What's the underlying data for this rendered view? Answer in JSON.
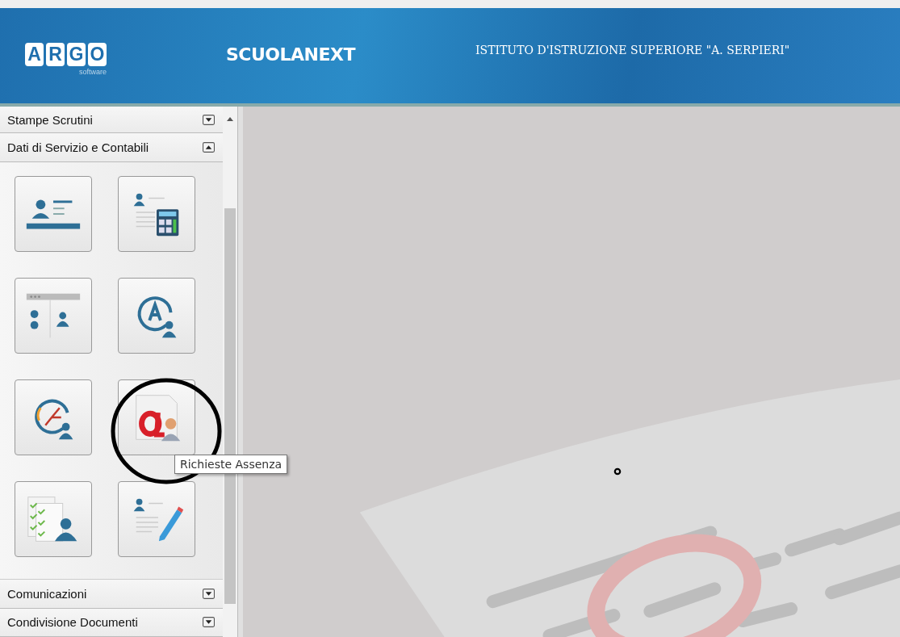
{
  "header": {
    "logo_letters": [
      "A",
      "R",
      "G",
      "O"
    ],
    "logo_caption": "software",
    "product": "SCUOLANEXT",
    "school": "ISTITUTO D'ISTRUZIONE SUPERIORE \"A. SERPIERI\""
  },
  "sidebar": {
    "sections": [
      {
        "label": "Stampe Scrutini",
        "expanded": false
      },
      {
        "label": "Dati di Servizio e Contabili",
        "expanded": true,
        "tiles": [
          {
            "kind": "id-card"
          },
          {
            "kind": "calculator"
          },
          {
            "kind": "people"
          },
          {
            "kind": "badge-a"
          },
          {
            "kind": "clock"
          },
          {
            "kind": "absence"
          },
          {
            "kind": "checklist"
          },
          {
            "kind": "edit"
          }
        ]
      },
      {
        "label": "Comunicazioni",
        "expanded": false
      },
      {
        "label": "Condivisione Documenti",
        "expanded": false
      }
    ]
  },
  "tooltip": {
    "text": "Richieste Assenza"
  }
}
